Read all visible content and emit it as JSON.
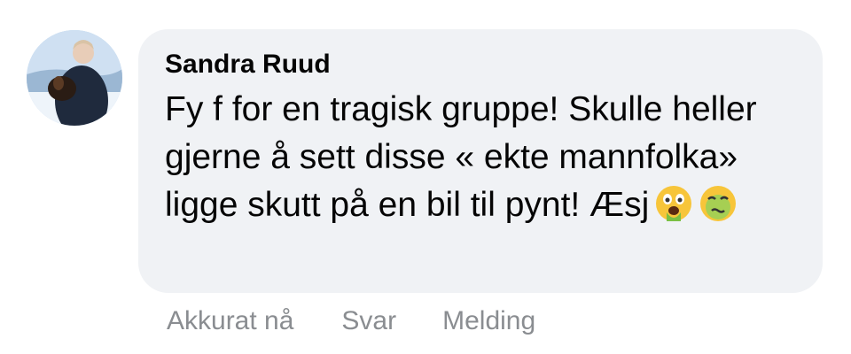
{
  "comment": {
    "author": "Sandra Ruud",
    "text": "Fy f for en tragisk gruppe! Skulle heller gjerne å sett disse « ekte mannfolka» ligge skutt på en bil til pynt! Æsj",
    "emojis": [
      "vomiting-face",
      "nauseated-face"
    ]
  },
  "actions": {
    "time": "Akkurat nå",
    "reply": "Svar",
    "message": "Melding"
  },
  "colors": {
    "bubble": "#f0f2f5",
    "meta_text": "#8a8d91",
    "text": "#050505"
  }
}
